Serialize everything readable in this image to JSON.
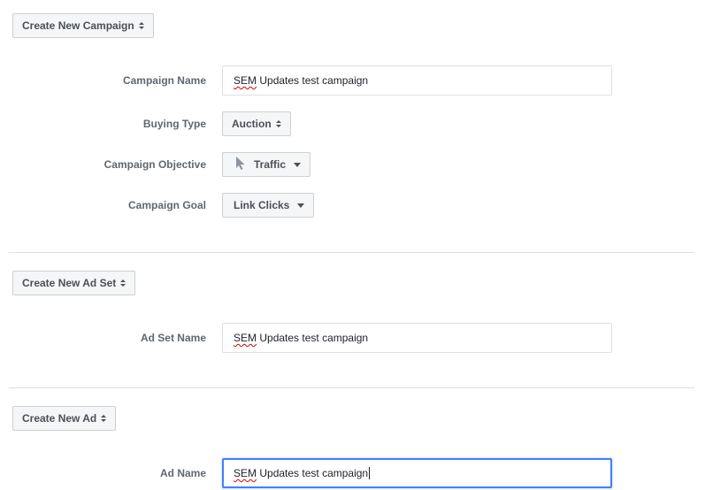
{
  "campaign": {
    "create_button": "Create New Campaign",
    "fields": {
      "name_label": "Campaign Name",
      "name_value": "SEM Updates test campaign",
      "buying_type_label": "Buying Type",
      "buying_type_value": "Auction",
      "objective_label": "Campaign Objective",
      "objective_value": "Traffic",
      "goal_label": "Campaign Goal",
      "goal_value": "Link Clicks"
    }
  },
  "ad_set": {
    "create_button": "Create New Ad Set",
    "name_label": "Ad Set Name",
    "name_value": "SEM Updates test campaign"
  },
  "ad": {
    "create_button": "Create New Ad",
    "name_label": "Ad Name",
    "name_value": "SEM Updates test campaign"
  },
  "spellcheck_word": "SEM",
  "colors": {
    "focus": "#4080ff",
    "divider": "#dddfe2",
    "button_bg": "#f5f6f7"
  }
}
